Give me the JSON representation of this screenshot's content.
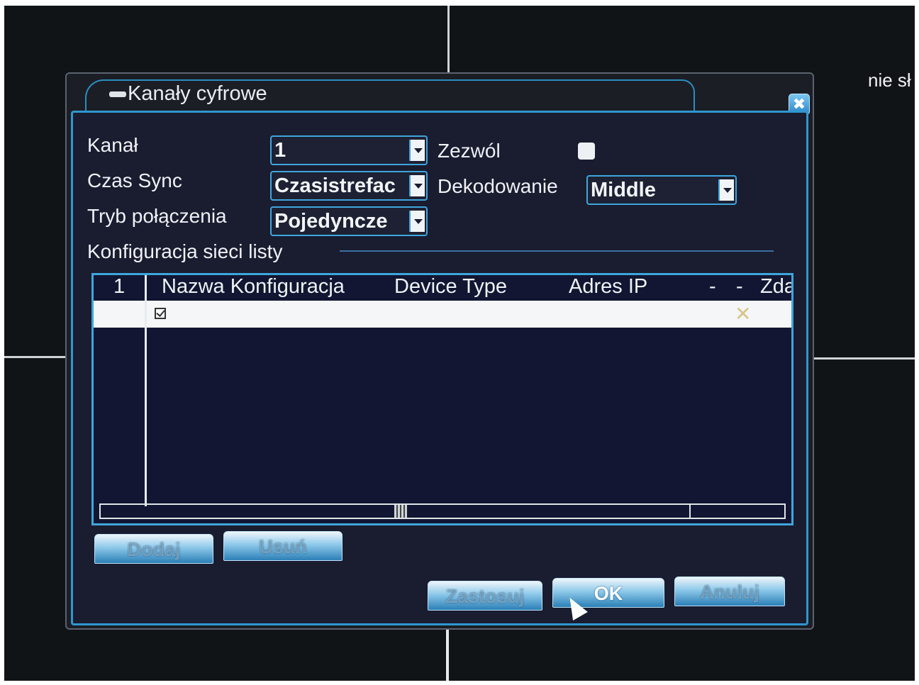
{
  "side_text": "nie sł",
  "dialog": {
    "title": "Kanały cyfrowe",
    "close": "✖"
  },
  "form": {
    "channel_label": "Kanał",
    "channel_value": "1",
    "enable_label": "Zezwól",
    "time_sync_label": "Czas Sync",
    "time_sync_value": "Czasistrefac",
    "decoding_label": "Dekodowanie",
    "decoding_value": "Middle",
    "connection_mode_label": "Tryb połączenia",
    "connection_mode_value": "Pojedyncze",
    "list_config_label": "Konfiguracja sieci listy"
  },
  "table": {
    "columns": [
      "1",
      "Nazwa Konfiguracja",
      "Device Type",
      "Adres IP",
      "-",
      "-",
      "Zda"
    ],
    "rows": [
      {
        "checked": true,
        "remove_icon": "✕"
      }
    ]
  },
  "buttons": {
    "bottom_left_1": "Dodaj",
    "bottom_left_2": "Usuń",
    "apply": "Zastosuj",
    "ok": "OK",
    "cancel": "Anuluj"
  }
}
